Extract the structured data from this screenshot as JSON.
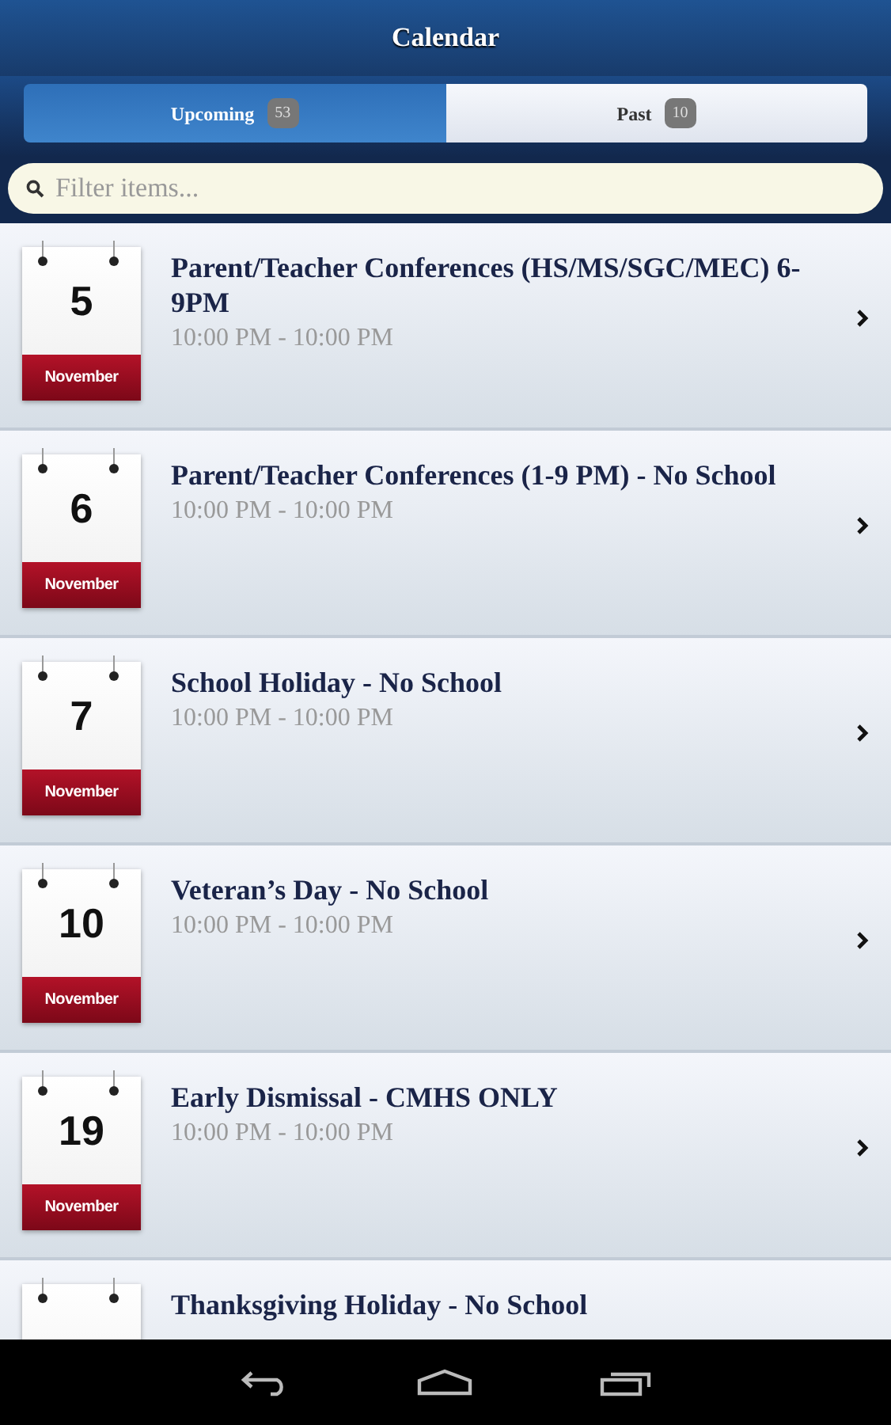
{
  "header": {
    "title": "Calendar"
  },
  "tabs": [
    {
      "label": "Upcoming",
      "count": "53",
      "selected": true
    },
    {
      "label": "Past",
      "count": "10",
      "selected": false
    }
  ],
  "search": {
    "placeholder": "Filter items..."
  },
  "events": [
    {
      "day": "5",
      "month": "November",
      "title": "Parent/Teacher Conferences (HS/MS/SGC/MEC) 6-9PM",
      "time": "10:00 PM - 10:00 PM"
    },
    {
      "day": "6",
      "month": "November",
      "title": "Parent/Teacher Conferences (1-9 PM) - No School",
      "time": "10:00 PM - 10:00 PM"
    },
    {
      "day": "7",
      "month": "November",
      "title": "School Holiday - No School",
      "time": "10:00 PM - 10:00 PM"
    },
    {
      "day": "10",
      "month": "November",
      "title": "Veteran’s Day - No School",
      "time": "10:00 PM - 10:00 PM"
    },
    {
      "day": "19",
      "month": "November",
      "title": "Early Dismissal - CMHS ONLY",
      "time": "10:00 PM - 10:00 PM"
    },
    {
      "title": "Thanksgiving Holiday - No School"
    }
  ]
}
